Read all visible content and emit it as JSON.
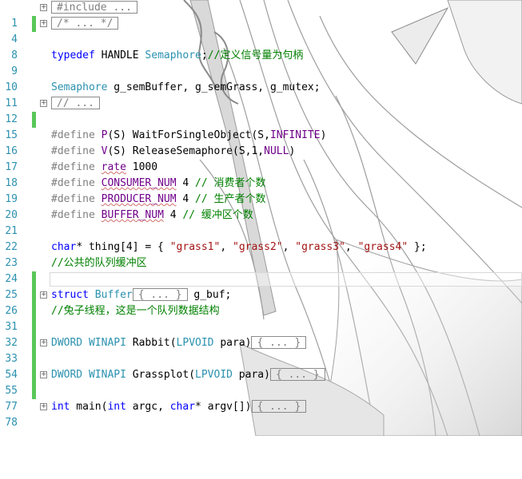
{
  "lines": [
    {
      "num": "1",
      "changed": false,
      "fold": true,
      "collapsed": "#include ..."
    },
    {
      "num": "4",
      "changed": true,
      "fold": true,
      "collapsed": "/* ... */"
    },
    {
      "num": "8",
      "changed": false,
      "fold": false
    },
    {
      "num": "9",
      "changed": false,
      "fold": false,
      "t1": "typedef",
      "t2": " HANDLE ",
      "t3": "Semaphore",
      "t4": ";",
      "c": "//定义信号量为句柄"
    },
    {
      "num": "10",
      "changed": false,
      "fold": false
    },
    {
      "num": "11",
      "changed": false,
      "fold": false,
      "t1": "Semaphore",
      "t2": " g_semBuffer, g_semGrass, g_mutex;"
    },
    {
      "num": "12",
      "changed": false,
      "fold": true,
      "collapsed": "// ..."
    },
    {
      "num": "15",
      "changed": true,
      "fold": false
    },
    {
      "num": "16",
      "changed": false,
      "fold": false,
      "d": "#define ",
      "m": "P",
      "a": "(S) WaitForSingleObject(S,",
      "m2": "INFINITE",
      "e": ")"
    },
    {
      "num": "17",
      "changed": false,
      "fold": false,
      "d": "#define ",
      "m": "V",
      "a": "(S) ReleaseSemaphore(S,1,",
      "m2": "NULL",
      "e": ")"
    },
    {
      "num": "18",
      "changed": false,
      "fold": false,
      "d": "#define ",
      "m": "rate",
      "a": " 1000"
    },
    {
      "num": "19",
      "changed": false,
      "fold": false,
      "d": "#define ",
      "m": "CONSUMER_NUM",
      "a": " 4 ",
      "c": "// 消费者个数"
    },
    {
      "num": "20",
      "changed": false,
      "fold": false,
      "d": "#define ",
      "m": "PRODUCER_NUM",
      "a": " 4 ",
      "c": "// 生产者个数"
    },
    {
      "num": "21",
      "changed": false,
      "fold": false,
      "d": "#define ",
      "m": "BUFFER_NUM",
      "a": " 4 ",
      "c": "// 缓冲区个数"
    },
    {
      "num": "22",
      "changed": false,
      "fold": false
    },
    {
      "num": "23",
      "changed": false,
      "fold": false,
      "k": "char",
      "a": "* thing[4] = { ",
      "s1": "\"grass1\"",
      "s2": "\"grass2\"",
      "s3": "\"grass3\"",
      "s4": "\"grass4\"",
      "e": " };"
    },
    {
      "num": "24",
      "changed": false,
      "fold": false,
      "c": "//公共的队列缓冲区"
    },
    {
      "num": "25",
      "changed": true,
      "fold": false
    },
    {
      "num": "26",
      "changed": true,
      "fold": true,
      "k": "struct",
      "t": " Buffer",
      "collapsed": "{ ... }",
      "e": " g_buf;"
    },
    {
      "num": "31",
      "changed": true,
      "fold": false,
      "c": "//兔子线程，这是一个队列数据结构"
    },
    {
      "num": "32",
      "changed": true,
      "fold": false
    },
    {
      "num": "33",
      "changed": true,
      "fold": true,
      "t": "DWORD WINAPI",
      "a": " Rabbit(",
      "t2": "LPVOID",
      "p": " para)",
      "collapsed": "{ ... }"
    },
    {
      "num": "54",
      "changed": true,
      "fold": false
    },
    {
      "num": "55",
      "changed": true,
      "fold": true,
      "t": "DWORD WINAPI",
      "a": " Grassplot(",
      "t2": "LPVOID",
      "p": " para)",
      "collapsed": "{ ... }"
    },
    {
      "num": "77",
      "changed": true,
      "fold": false
    },
    {
      "num": "78",
      "changed": false,
      "fold": true,
      "k": "int",
      "a": " main(",
      "k2": "int",
      "a2": " argc, ",
      "k3": "char",
      "a3": "* argv[])",
      "collapsed": "{ ... }"
    }
  ],
  "colors": {
    "keyword": "#0000ff",
    "type": "#2b91af",
    "comment": "#008000",
    "macro": "#6f008a",
    "string": "#a31515",
    "line_number": "#2b91af",
    "change_bar": "#59c759"
  },
  "icons": [
    "fold-plus-icon",
    "anime-sketch-background"
  ]
}
